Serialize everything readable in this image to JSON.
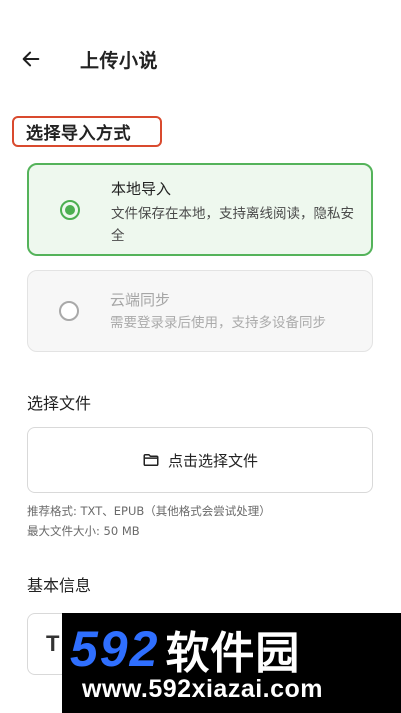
{
  "header": {
    "back_icon": "arrow-left-icon",
    "title": "上传小说"
  },
  "import_mode": {
    "section_title": "选择导入方式",
    "highlight_color": "#d94a2e",
    "options": [
      {
        "label": "本地导入",
        "description": "文件保存在本地，支持离线阅读，隐私安全",
        "selected": true,
        "enabled": true
      },
      {
        "label": "云端同步",
        "description": "需要登录录后使用，支持多设备同步",
        "selected": false,
        "enabled": false
      }
    ]
  },
  "file": {
    "section_title": "选择文件",
    "button_icon": "folder-icon",
    "button_label": "点击选择文件",
    "hint_formats": "推荐格式: TXT、EPUB（其他格式会尝试处理）",
    "hint_size": "最大文件大小: 50 MB"
  },
  "basic_info": {
    "section_title": "基本信息",
    "field_glyph": "T"
  },
  "watermark": {
    "brand_digits": "592",
    "brand_text": "软件园",
    "url": "www.592xiazai.com"
  },
  "colors": {
    "accent_green": "#4caf50",
    "selected_bg": "#eef8ee",
    "watermark_blue": "#2f6fff"
  }
}
